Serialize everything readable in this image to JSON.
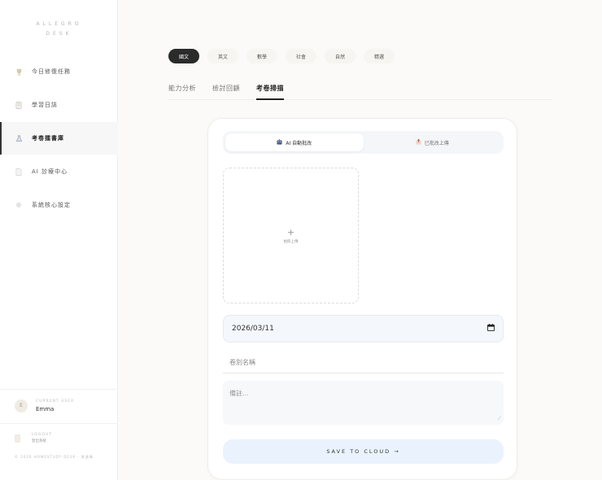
{
  "brand": {
    "line1": "ALLEGRO",
    "line2": "DESK"
  },
  "sidebar": {
    "items": [
      {
        "icon": "trophy-icon",
        "label": "今日修復任務"
      },
      {
        "icon": "notebook-icon",
        "label": "學習日誌"
      },
      {
        "icon": "flask-icon",
        "label": "考卷擂書庫"
      },
      {
        "icon": "document-icon",
        "label": "AI 診療中心"
      },
      {
        "icon": "dot-icon",
        "label": "系統核心設定"
      }
    ],
    "active_index": 2
  },
  "user": {
    "caption": "CURRENT USER",
    "name": "Emma",
    "avatar_text": "E"
  },
  "logout": {
    "caption": "LOGOUT",
    "sub": "登出系統"
  },
  "copyright": "© 2026 HOMESTUDY·DESK · 資源庫",
  "subjects": [
    "國文",
    "英文",
    "數學",
    "社會",
    "自然",
    "精選"
  ],
  "active_subject": "國文",
  "tabs": [
    "能力分析",
    "檢討回顧",
    "考卷掃描"
  ],
  "active_tab": "考卷掃描",
  "modes": [
    {
      "icon": "ai-icon",
      "label": "AI 自動批改"
    },
    {
      "icon": "upload-box-icon",
      "label": "已批改上傳"
    }
  ],
  "upload": {
    "plus": "+",
    "label": "拍照上傳"
  },
  "date_value": "2026/03/11",
  "name_placeholder": "卷別名稱",
  "note_placeholder": "備註...",
  "save_label": "SAVE TO CLOUD →"
}
